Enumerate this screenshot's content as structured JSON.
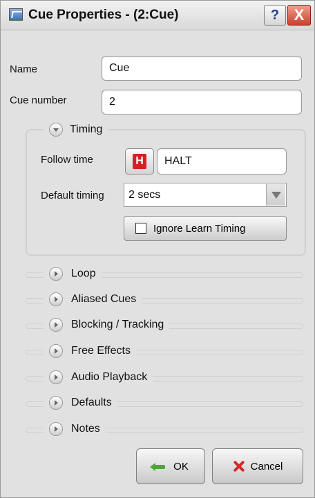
{
  "window": {
    "title": "Cue Properties - (2:Cue)",
    "help_label": "?",
    "close_label": "X"
  },
  "form": {
    "name_label": "Name",
    "name_value": "Cue",
    "cue_number_label": "Cue number",
    "cue_number_value": "2"
  },
  "timing": {
    "title": "Timing",
    "follow_time_label": "Follow time",
    "follow_icon_text": "H",
    "follow_value": "HALT",
    "default_timing_label": "Default timing",
    "default_timing_value": "2 secs",
    "ignore_learn_label": "Ignore Learn Timing",
    "ignore_learn_checked": false
  },
  "sections": [
    {
      "label": "Loop"
    },
    {
      "label": "Aliased Cues"
    },
    {
      "label": "Blocking / Tracking"
    },
    {
      "label": "Free Effects"
    },
    {
      "label": "Audio Playback"
    },
    {
      "label": "Defaults"
    },
    {
      "label": "Notes"
    }
  ],
  "buttons": {
    "ok_label": "OK",
    "cancel_label": "Cancel"
  },
  "colors": {
    "window_bg": "#e1e1e1",
    "halt_red": "#d91f26",
    "ok_green": "#4ea733",
    "cancel_red": "#d12a2a"
  }
}
